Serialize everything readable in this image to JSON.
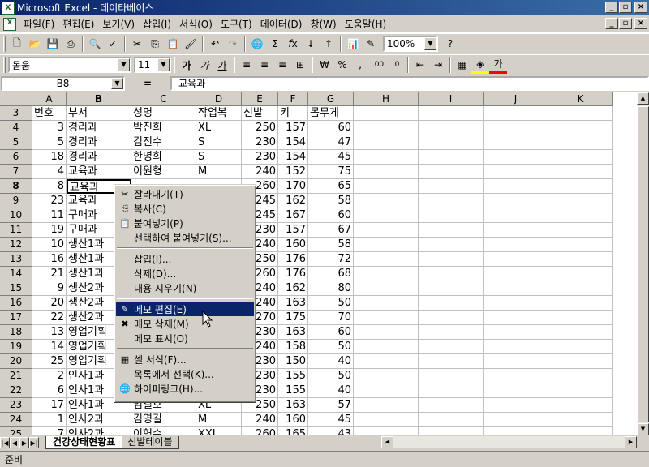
{
  "title": "Microsoft Excel - 데이타베이스",
  "app_icon": "excel-icon",
  "menu": [
    "파일(F)",
    "편집(E)",
    "보기(V)",
    "삽입(I)",
    "서식(O)",
    "도구(T)",
    "데이터(D)",
    "창(W)",
    "도움말(H)"
  ],
  "toolbar": {
    "zoom": "100%",
    "font_name": "돋움",
    "font_size": "11"
  },
  "formula": {
    "cell_ref": "B8",
    "eq": "=",
    "value": "교육과"
  },
  "columns": [
    "A",
    "B",
    "C",
    "D",
    "E",
    "F",
    "G",
    "H",
    "I",
    "J",
    "K"
  ],
  "rows": [
    {
      "n": "3",
      "a": "번호",
      "b": "부서",
      "c": "성명",
      "d": "작업복",
      "e": "신발",
      "f": "키",
      "g": "몸무게"
    },
    {
      "n": "4",
      "a": "3",
      "b": "경리과",
      "c": "박진희",
      "d": "XL",
      "e": "250",
      "f": "157",
      "g": "60"
    },
    {
      "n": "5",
      "a": "5",
      "b": "경리과",
      "c": "김진수",
      "d": "S",
      "e": "230",
      "f": "154",
      "g": "47"
    },
    {
      "n": "6",
      "a": "18",
      "b": "경리과",
      "c": "한명희",
      "d": "S",
      "e": "230",
      "f": "154",
      "g": "45"
    },
    {
      "n": "7",
      "a": "4",
      "b": "교육과",
      "c": "이원형",
      "d": "M",
      "e": "240",
      "f": "152",
      "g": "75"
    },
    {
      "n": "8",
      "a": "8",
      "b": "교육과",
      "c": "",
      "d": "",
      "e": "260",
      "f": "170",
      "g": "65"
    },
    {
      "n": "9",
      "a": "23",
      "b": "교육과",
      "c": "",
      "d": "",
      "e": "245",
      "f": "162",
      "g": "58"
    },
    {
      "n": "10",
      "a": "11",
      "b": "구매과",
      "c": "",
      "d": "",
      "e": "245",
      "f": "167",
      "g": "60"
    },
    {
      "n": "11",
      "a": "19",
      "b": "구매과",
      "c": "",
      "d": "",
      "e": "230",
      "f": "157",
      "g": "67"
    },
    {
      "n": "12",
      "a": "10",
      "b": "생산1과",
      "c": "",
      "d": "",
      "e": "240",
      "f": "160",
      "g": "58"
    },
    {
      "n": "13",
      "a": "16",
      "b": "생산1과",
      "c": "",
      "d": "",
      "e": "250",
      "f": "176",
      "g": "72"
    },
    {
      "n": "14",
      "a": "21",
      "b": "생산1과",
      "c": "",
      "d": "",
      "e": "260",
      "f": "176",
      "g": "68"
    },
    {
      "n": "15",
      "a": "9",
      "b": "생산2과",
      "c": "",
      "d": "",
      "e": "240",
      "f": "162",
      "g": "80"
    },
    {
      "n": "16",
      "a": "20",
      "b": "생산2과",
      "c": "",
      "d": "",
      "e": "240",
      "f": "163",
      "g": "50"
    },
    {
      "n": "17",
      "a": "22",
      "b": "생산2과",
      "c": "",
      "d": "",
      "e": "270",
      "f": "175",
      "g": "70"
    },
    {
      "n": "18",
      "a": "13",
      "b": "영업기획",
      "c": "",
      "d": "",
      "e": "230",
      "f": "163",
      "g": "60"
    },
    {
      "n": "19",
      "a": "14",
      "b": "영업기획",
      "c": "",
      "d": "",
      "e": "240",
      "f": "158",
      "g": "50"
    },
    {
      "n": "20",
      "a": "25",
      "b": "영업기획",
      "c": "",
      "d": "",
      "e": "230",
      "f": "150",
      "g": "40"
    },
    {
      "n": "21",
      "a": "2",
      "b": "인사1과",
      "c": "",
      "d": "",
      "e": "230",
      "f": "155",
      "g": "50"
    },
    {
      "n": "22",
      "a": "6",
      "b": "인사1과",
      "c": "",
      "d": "",
      "e": "230",
      "f": "155",
      "g": "40"
    },
    {
      "n": "23",
      "a": "17",
      "b": "인사1과",
      "c": "임길호",
      "d": "XL",
      "e": "250",
      "f": "163",
      "g": "57"
    },
    {
      "n": "24",
      "a": "1",
      "b": "인사2과",
      "c": "김영길",
      "d": "M",
      "e": "240",
      "f": "160",
      "g": "45"
    },
    {
      "n": "25",
      "a": "7",
      "b": "인사2과",
      "c": "이형수",
      "d": "XXL",
      "e": "260",
      "f": "165",
      "g": "43"
    }
  ],
  "context_menu": [
    {
      "label": "잘라내기(T)",
      "icon": "scissors-icon"
    },
    {
      "label": "복사(C)",
      "icon": "copy-icon"
    },
    {
      "label": "붙여넣기(P)",
      "icon": "paste-icon"
    },
    {
      "label": "선택하여 붙여넣기(S)...",
      "icon": ""
    },
    {
      "sep": true
    },
    {
      "label": "삽입(I)...",
      "icon": ""
    },
    {
      "label": "삭제(D)...",
      "icon": ""
    },
    {
      "label": "내용 지우기(N)",
      "icon": ""
    },
    {
      "sep": true
    },
    {
      "label": "메모 편집(E)",
      "icon": "edit-comment-icon",
      "highlight": true
    },
    {
      "label": "메모 삭제(M)",
      "icon": "delete-comment-icon"
    },
    {
      "label": "메모 표시(O)",
      "icon": ""
    },
    {
      "sep": true
    },
    {
      "label": "셀 서식(F)...",
      "icon": "format-cells-icon"
    },
    {
      "label": "목록에서 선택(K)...",
      "icon": ""
    },
    {
      "label": "하이퍼링크(H)...",
      "icon": "hyperlink-icon"
    }
  ],
  "tabs": [
    "건강상태현황표",
    "신발테이블"
  ],
  "status": "준비"
}
